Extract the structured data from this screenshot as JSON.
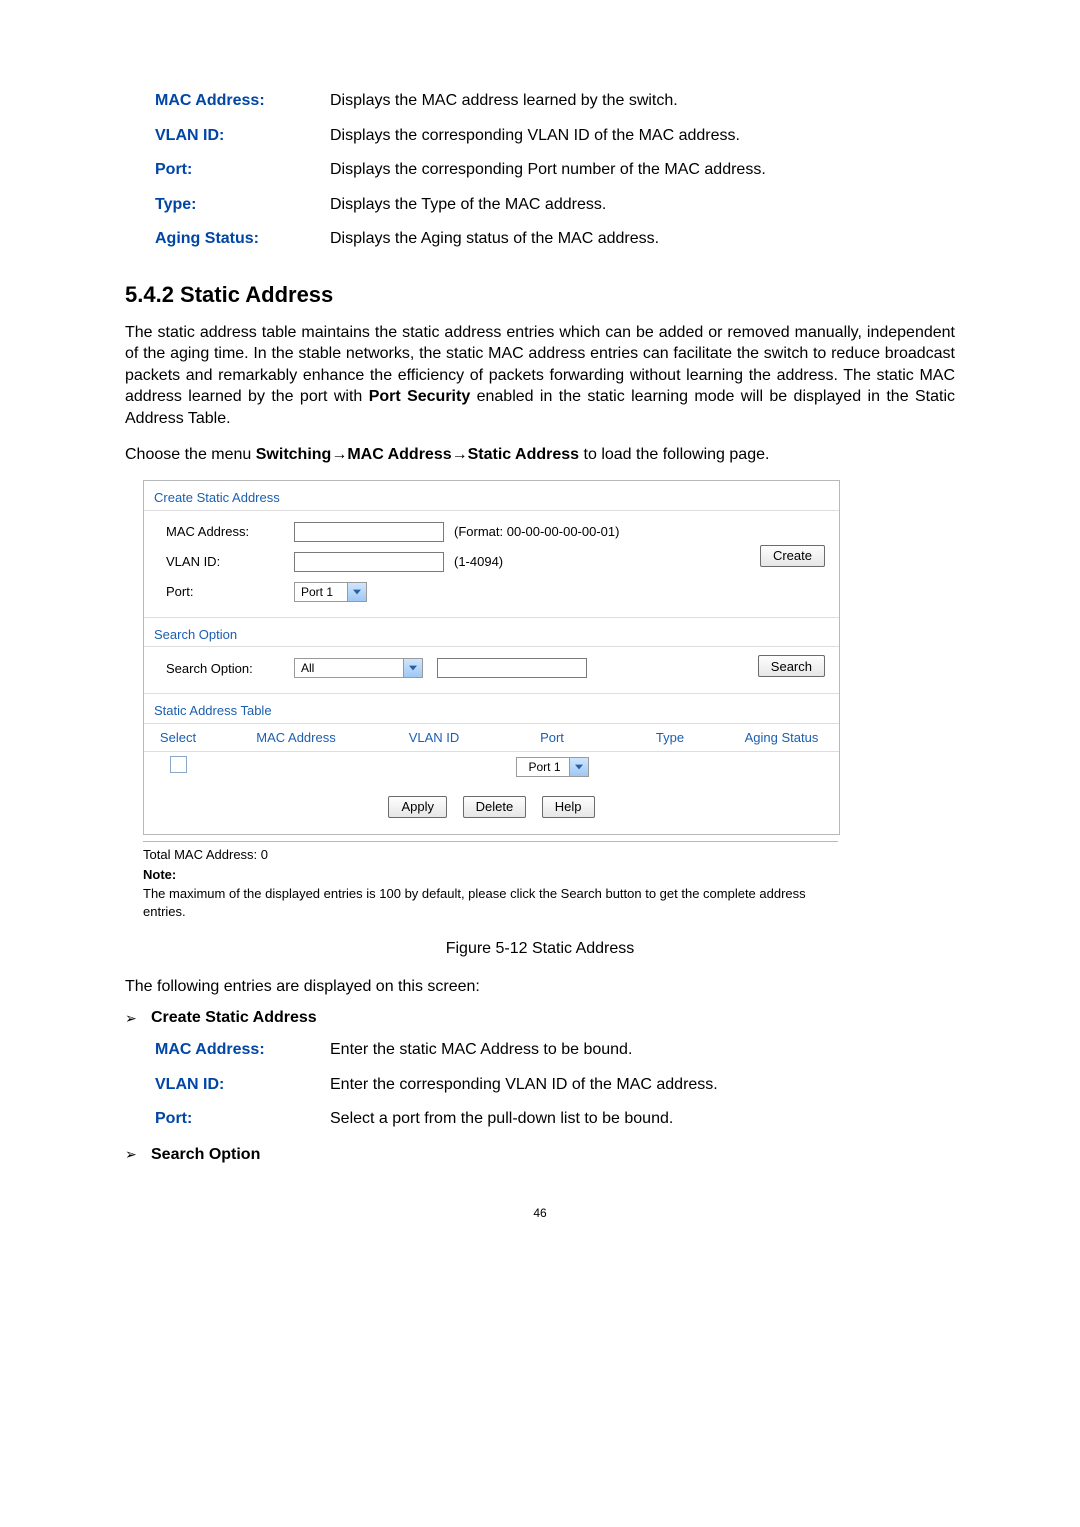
{
  "top_defs": [
    {
      "term": "MAC Address:",
      "desc": "Displays the MAC address learned by the switch."
    },
    {
      "term": "VLAN ID:",
      "desc": "Displays the corresponding VLAN ID of the MAC address."
    },
    {
      "term": "Port:",
      "desc": "Displays the corresponding Port number of the MAC address."
    },
    {
      "term": "Type:",
      "desc": "Displays the Type of the MAC address."
    },
    {
      "term": "Aging Status:",
      "desc": "Displays the Aging status of the MAC address."
    }
  ],
  "section_title": "5.4.2 Static Address",
  "intro": {
    "p1_a": "The static address table maintains the static address entries which can be added or removed manually, independent of the aging time. In the stable networks, the static MAC address entries can facilitate the switch to reduce broadcast packets and remarkably enhance the efficiency of packets forwarding without learning the address. The static MAC address learned by the port with ",
    "p1_b": "Port Security",
    "p1_c": " enabled in the static learning mode will be displayed in the Static Address Table.",
    "p2_a": "Choose the menu ",
    "p2_b": "Switching",
    "p2_arrow": "→",
    "p2_c": "MAC Address",
    "p2_d": "Static Address",
    "p2_e": " to load the following page."
  },
  "figure": {
    "panels": {
      "create_title": "Create Static Address",
      "mac_label": "MAC Address:",
      "mac_hint": "(Format: 00-00-00-00-00-01)",
      "vlan_label": "VLAN ID:",
      "vlan_hint": "(1-4094)",
      "port_label": "Port:",
      "port_value": "Port 1",
      "create_btn": "Create",
      "search_title": "Search Option",
      "search_label": "Search Option:",
      "search_value": "All",
      "search_btn": "Search",
      "table_title": "Static Address Table",
      "cols": {
        "select": "Select",
        "mac": "MAC Address",
        "vlan": "VLAN ID",
        "port": "Port",
        "type": "Type",
        "aging": "Aging Status"
      },
      "row_port": "Port 1",
      "apply_btn": "Apply",
      "delete_btn": "Delete",
      "help_btn": "Help"
    },
    "total_line": "Total MAC Address: 0",
    "note_head": "Note:",
    "note_body": "The maximum of the displayed entries is 100 by default, please click the Search button to get the complete address entries.",
    "caption": "Figure 5-12 Static Address"
  },
  "after": {
    "lead": "The following entries are displayed on this screen:",
    "bullet1": "Create Static Address",
    "defs": [
      {
        "term": "MAC Address:",
        "desc": "Enter the static MAC Address to be bound."
      },
      {
        "term": "VLAN ID:",
        "desc": "Enter the corresponding VLAN ID of the MAC address."
      },
      {
        "term": "Port:",
        "desc": "Select a port from the pull-down list to be bound."
      }
    ],
    "bullet2": "Search Option"
  },
  "page_number": "46"
}
